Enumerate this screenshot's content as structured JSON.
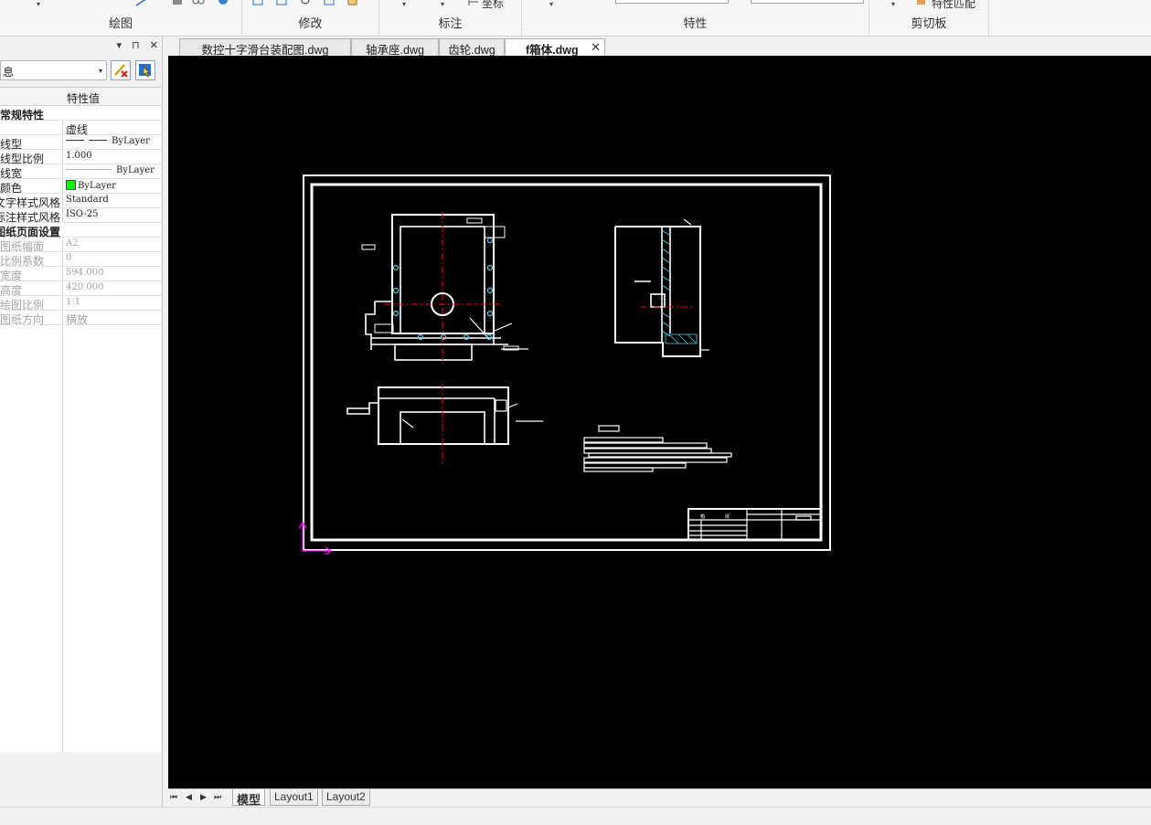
{
  "ribbon": {
    "groups": [
      {
        "label": "绘图"
      },
      {
        "label": "修改"
      },
      {
        "label": "标注",
        "partial_text": "坐标"
      },
      {
        "label": "特性"
      },
      {
        "label": "剪切板",
        "partial_text": "特性匹配"
      }
    ]
  },
  "properties_panel": {
    "controls": [
      "▾",
      "⊓",
      "✕"
    ],
    "selector_value": "息",
    "grid_header": "特性值",
    "rows": [
      {
        "kind": "section",
        "key": "常规特性"
      },
      {
        "kind": "row",
        "key": "",
        "value": "虚线",
        "cn": true
      },
      {
        "kind": "row",
        "key": "线型",
        "value": "ByLayer",
        "linetype": true
      },
      {
        "kind": "row",
        "key": "线型比例",
        "value": "1.000"
      },
      {
        "kind": "row",
        "key": "线宽",
        "value": "ByLayer",
        "lineweight": true
      },
      {
        "kind": "row",
        "key": "颜色",
        "value": "ByLayer",
        "swatch": "#00ff00"
      },
      {
        "kind": "row",
        "key": "文字样式风格",
        "value": "Standard"
      },
      {
        "kind": "row",
        "key": "标注样式风格",
        "value": "ISO-25"
      },
      {
        "kind": "section",
        "key": "图纸页面设置"
      },
      {
        "kind": "row",
        "key": "图纸幅面",
        "value": "A2",
        "disabled": true
      },
      {
        "kind": "row",
        "key": "比例系数",
        "value": "0",
        "disabled": true
      },
      {
        "kind": "row",
        "key": "宽度",
        "value": "594.000",
        "disabled": true
      },
      {
        "kind": "row",
        "key": "高度",
        "value": "420.000",
        "disabled": true
      },
      {
        "kind": "row",
        "key": "绘图比例",
        "value": "1:1",
        "disabled": true
      },
      {
        "kind": "row",
        "key": "图纸方向",
        "value": "横放",
        "disabled": true,
        "cn": true
      }
    ]
  },
  "document_tabs": [
    {
      "label": "数控十字滑台装配图.dwg",
      "active": false
    },
    {
      "label": "轴承座.dwg",
      "active": false
    },
    {
      "label": "齿轮.dwg",
      "active": false
    },
    {
      "label": "f箱体.dwg",
      "active": true,
      "close": "✕"
    }
  ],
  "layout_tabs": {
    "nav": [
      "⏮",
      "◀",
      "▶",
      "⏭"
    ],
    "tabs": [
      {
        "label": "模型",
        "active": true
      },
      {
        "label": "Layout1",
        "active": false
      },
      {
        "label": "Layout2",
        "active": false
      }
    ]
  },
  "drawing": {
    "title_block": {
      "name_cell": "箱",
      "name_cell2": "体"
    }
  },
  "colors": {
    "canvas_bg": "#000000",
    "drawing_line": "#ffffff",
    "centerline": "#ff0000",
    "hatch": "#4fd0e4",
    "ucs_icon": "#ff00ff"
  }
}
